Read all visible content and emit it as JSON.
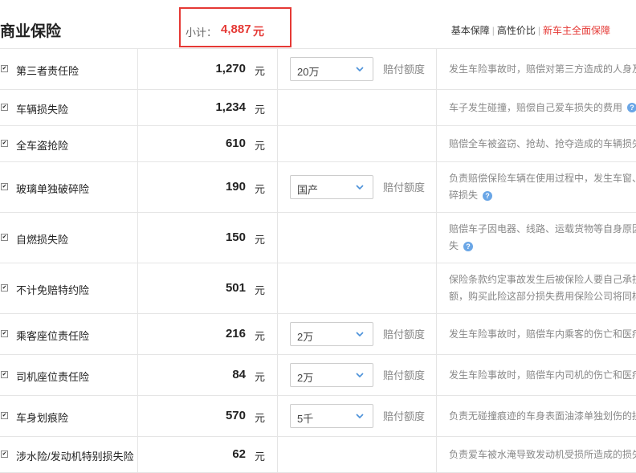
{
  "header": {
    "title": "商业保险",
    "subtotal_label": "小计：",
    "subtotal_value": "4,887",
    "subtotal_unit": "元",
    "plans": [
      "基本保障",
      "高性价比",
      "新车主全面保障"
    ],
    "active_plan": "新车主全面保障"
  },
  "colors": {
    "accent_red": "#e53935",
    "help_icon": "#6aa6e6"
  },
  "limit_label": "赔付额度",
  "items": [
    {
      "name": "第三者责任险",
      "price": "1,270",
      "unit": "元",
      "select": "20万",
      "limit": "赔付额度",
      "desc": [
        "发生车险事故时，赔偿对第三方造成的人身及"
      ],
      "help": false
    },
    {
      "name": "车辆损失险",
      "price": "1,234",
      "unit": "元",
      "select": "",
      "limit": "",
      "desc": [
        "车子发生碰撞，赔偿自己爱车损失的费用"
      ],
      "help": true
    },
    {
      "name": "全车盗抢险",
      "price": "610",
      "unit": "元",
      "select": "",
      "limit": "",
      "desc": [
        "赔偿全车被盗窃、抢劫、抢夺造成的车辆损失"
      ],
      "help": false
    },
    {
      "name": "玻璃单独破碎险",
      "price": "190",
      "unit": "元",
      "select": "国产",
      "limit": "赔付额度",
      "desc": [
        "负责赔偿保险车辆在使用过程中，发生车窗、",
        "碎损失"
      ],
      "help": true
    },
    {
      "name": "自燃损失险",
      "price": "150",
      "unit": "元",
      "select": "",
      "limit": "",
      "desc": [
        "赔偿车子因电器、线路、运载货物等自身原因",
        "失"
      ],
      "help": true
    },
    {
      "name": "不计免赔特约险",
      "price": "501",
      "unit": "元",
      "select": "",
      "limit": "",
      "desc": [
        "保险条款约定事故发生后被保险人要自己承担",
        "额，购买此险这部分损失费用保险公司将同样"
      ],
      "help": false
    },
    {
      "name": "乘客座位责任险",
      "price": "216",
      "unit": "元",
      "select": "2万",
      "limit": "赔付额度",
      "desc": [
        "发生车险事故时，赔偿车内乘客的伤亡和医疗"
      ],
      "help": false
    },
    {
      "name": "司机座位责任险",
      "price": "84",
      "unit": "元",
      "select": "2万",
      "limit": "赔付额度",
      "desc": [
        "发生车险事故时，赔偿车内司机的伤亡和医疗"
      ],
      "help": false
    },
    {
      "name": "车身划痕险",
      "price": "570",
      "unit": "元",
      "select": "5千",
      "limit": "赔付额度",
      "desc": [
        "负责无碰撞痕迹的车身表面油漆单独划伤的损"
      ],
      "help": false
    },
    {
      "name": "涉水险/发动机特别损失险",
      "price": "62",
      "unit": "元",
      "select": "",
      "limit": "",
      "desc": [
        "负责爱车被水淹导致发动机受损所造成的损失"
      ],
      "help": false
    }
  ]
}
